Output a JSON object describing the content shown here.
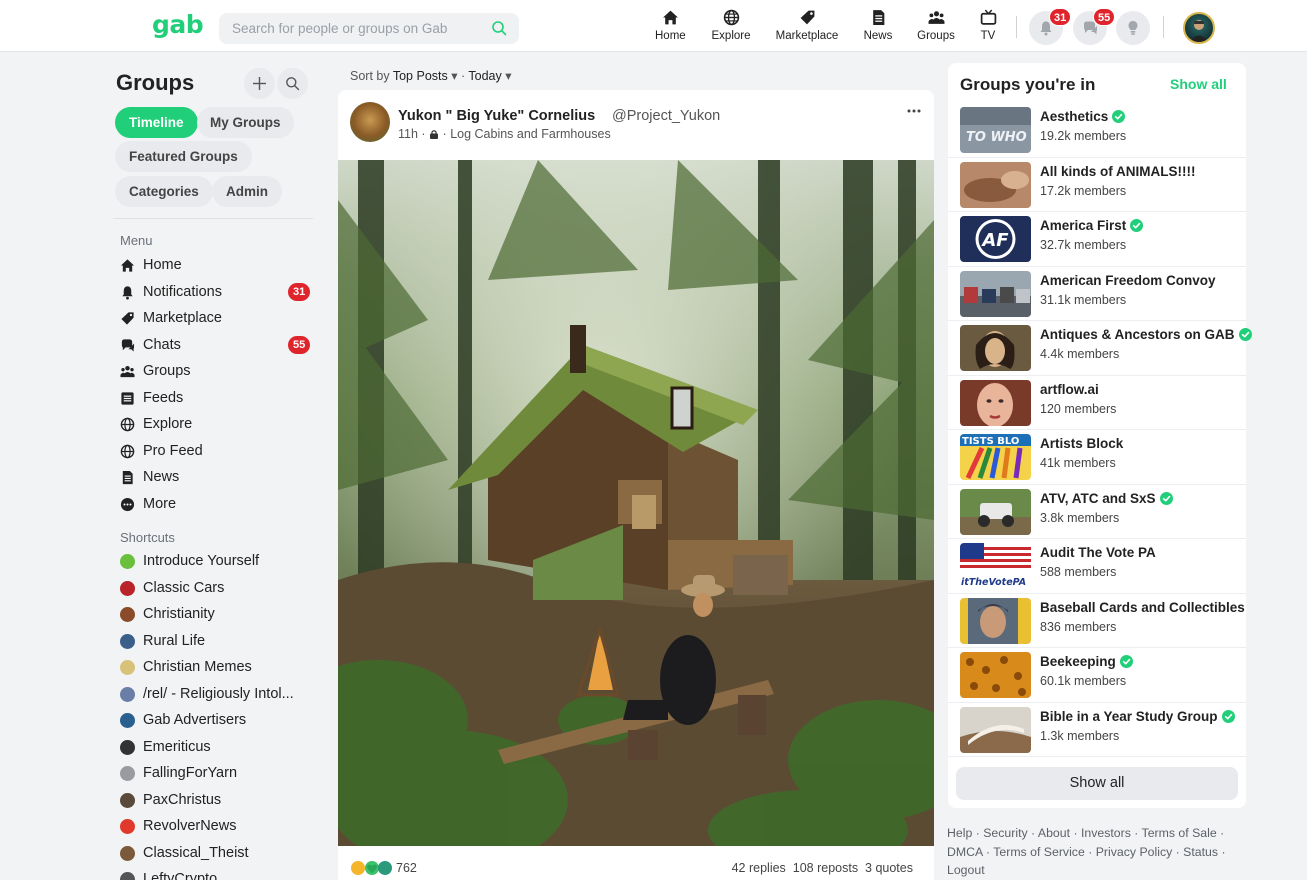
{
  "topbar": {
    "logo": "gab",
    "search_placeholder": "Search for people or groups on Gab",
    "nav": [
      {
        "label": "Home",
        "icon": "home-icon"
      },
      {
        "label": "Explore",
        "icon": "globe-icon"
      },
      {
        "label": "Marketplace",
        "icon": "tag-icon"
      },
      {
        "label": "News",
        "icon": "news-icon"
      },
      {
        "label": "Groups",
        "icon": "groups-icon"
      },
      {
        "label": "TV",
        "icon": "tv-icon"
      }
    ],
    "notifications_badge": "31",
    "chats_badge": "55"
  },
  "left": {
    "title": "Groups",
    "pills": [
      "Timeline",
      "My Groups",
      "Featured Groups",
      "Categories",
      "Admin"
    ],
    "menu_title": "Menu",
    "menu": [
      {
        "label": "Home",
        "icon": "home-icon"
      },
      {
        "label": "Notifications",
        "icon": "bell-icon",
        "badge": "31"
      },
      {
        "label": "Marketplace",
        "icon": "tag-icon"
      },
      {
        "label": "Chats",
        "icon": "chat-icon",
        "badge": "55"
      },
      {
        "label": "Groups",
        "icon": "groups-icon"
      },
      {
        "label": "Feeds",
        "icon": "list-icon"
      },
      {
        "label": "Explore",
        "icon": "globe-icon"
      },
      {
        "label": "Pro Feed",
        "icon": "globe-icon"
      },
      {
        "label": "News",
        "icon": "news-icon"
      },
      {
        "label": "More",
        "icon": "more-icon"
      }
    ],
    "shortcuts_title": "Shortcuts",
    "shortcuts": [
      {
        "label": "Introduce Yourself",
        "color": "#6abf3d"
      },
      {
        "label": "Classic Cars",
        "color": "#b8242a"
      },
      {
        "label": "Christianity",
        "color": "#8a4b2a"
      },
      {
        "label": "Rural Life",
        "color": "#3a5f8a"
      },
      {
        "label": "Christian Memes",
        "color": "#d8c27a"
      },
      {
        "label": "/rel/ - Religiously Intol...",
        "color": "#6a7fa8"
      },
      {
        "label": "Gab Advertisers",
        "color": "#2a5f8f"
      },
      {
        "label": "Emeriticus",
        "color": "#333333"
      },
      {
        "label": "FallingForYarn",
        "color": "#9a9aa0"
      },
      {
        "label": "PaxChristus",
        "color": "#5a4a3a"
      },
      {
        "label": "RevolverNews",
        "color": "#e0392b"
      },
      {
        "label": "Classical_Theist",
        "color": "#7a5a3a"
      },
      {
        "label": "LeftyCrypto",
        "color": "#555555"
      }
    ]
  },
  "feed": {
    "sort_label": "Sort by",
    "sort_value": "Top Posts",
    "time_value": "Today",
    "post": {
      "author": "Yukon \" Big Yuke\" Cornelius",
      "handle": "@Project_Yukon",
      "time": "11h",
      "group": "Log Cabins and Farmhouses",
      "likes": "762",
      "replies": "42 replies",
      "reposts": "108 reposts",
      "quotes": "3 quotes"
    }
  },
  "right": {
    "title": "Groups you're in",
    "show_all_link": "Show all",
    "groups": [
      {
        "name": "Aesthetics",
        "members": "19.2k members",
        "verified": true
      },
      {
        "name": "All kinds of ANIMALS!!!!",
        "members": "17.2k members",
        "verified": false
      },
      {
        "name": "America First",
        "members": "32.7k members",
        "verified": true
      },
      {
        "name": "American Freedom Convoy",
        "members": "31.1k members",
        "verified": false
      },
      {
        "name": "Antiques & Ancestors on GAB",
        "members": "4.4k members",
        "verified": true
      },
      {
        "name": "artflow.ai",
        "members": "120 members",
        "verified": false
      },
      {
        "name": "Artists Block",
        "members": "41k members",
        "verified": false
      },
      {
        "name": "ATV, ATC and SxS",
        "members": "3.8k members",
        "verified": true
      },
      {
        "name": "Audit The Vote PA",
        "members": "588 members",
        "verified": false
      },
      {
        "name": "Baseball Cards and Collectibles",
        "members": "836 members",
        "verified": false
      },
      {
        "name": "Beekeeping",
        "members": "60.1k members",
        "verified": true
      },
      {
        "name": "Bible in a Year Study Group",
        "members": "1.3k members",
        "verified": true
      }
    ],
    "show_all_button": "Show all",
    "thumb_texts": {
      "aesthetics": "TO WHO",
      "america_first": "AF",
      "artists_block": "TISTS BLO",
      "audit": "itTheVotePA"
    }
  },
  "footer": {
    "line1": "Help · Security · About · Investors · Terms of Sale ·",
    "line2": "DMCA · Terms of Service · Privacy Policy · Status ·",
    "line3": "Logout"
  },
  "colors": {
    "accent": "#21cf7a",
    "badge": "#e0242b",
    "verified": "#21cf7a"
  }
}
